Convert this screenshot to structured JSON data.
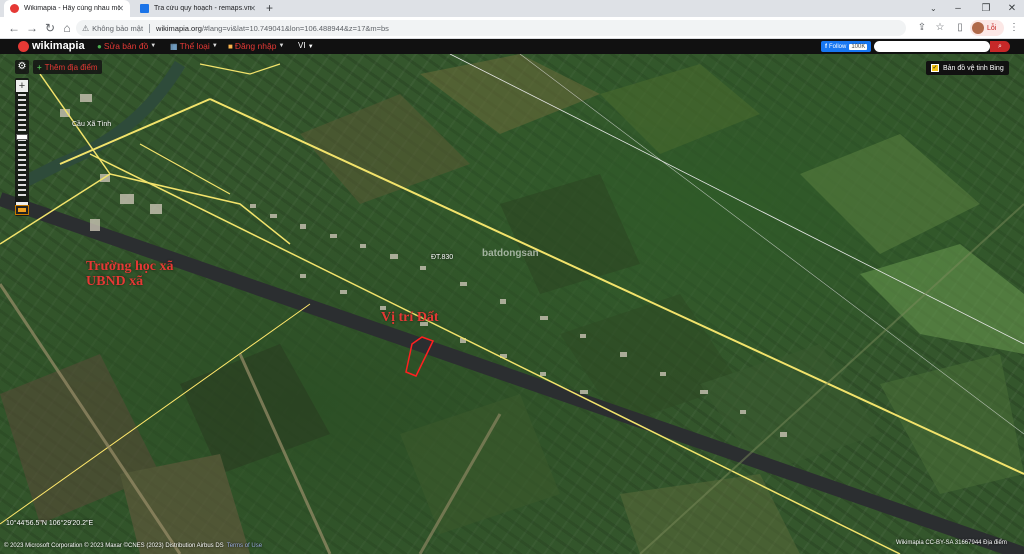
{
  "browser": {
    "tabs": [
      {
        "title": "Wikimapia - Hãy cùng nhau mô tả"
      },
      {
        "title": "Tra cứu quy hoạch - remaps.vn"
      }
    ],
    "address": {
      "security_label": "Không bảo mật",
      "host": "wikimapia.org",
      "path": "/#lang=vi&lat=10.749041&lon=106.488944&z=17&m=bs"
    },
    "profile_label": "Lỗi"
  },
  "wikimapia": {
    "logo": "wikimapia",
    "menu": {
      "edit_map": "Sửa bản đồ",
      "categories": "Thể loại",
      "login": "Đăng nhập",
      "language": "VI"
    },
    "facebook": {
      "label": "Follow",
      "count": "100K"
    }
  },
  "map": {
    "add_place": "Thêm địa điểm",
    "satellite_toggle": "Bản đồ vệ tinh Bing",
    "label_school": "Trường học xã\nUBND xã",
    "label_school_line1": "Trường học xã",
    "label_school_line2": "UBND xã",
    "label_lot": "Vị trí Đất",
    "label_bridge": "Cầu Xã Tình",
    "label_road": "ĐT.830",
    "watermark": "batdongsan",
    "coords": "10°44'56.5\"N 106°29'20.2\"E",
    "copyright": "© 2023 Microsoft Corporation © 2023 Maxar ©CNES (2023) Distribution Airbus DS",
    "terms": "Terms of Use",
    "attribution": "Wikimapia CC-BY-SA  31667944 Địa điểm"
  },
  "colors": {
    "accent_red": "#e53935",
    "road_yellow": "#f2e36b",
    "wm_bar": "#111111",
    "facebook": "#1877f2"
  }
}
